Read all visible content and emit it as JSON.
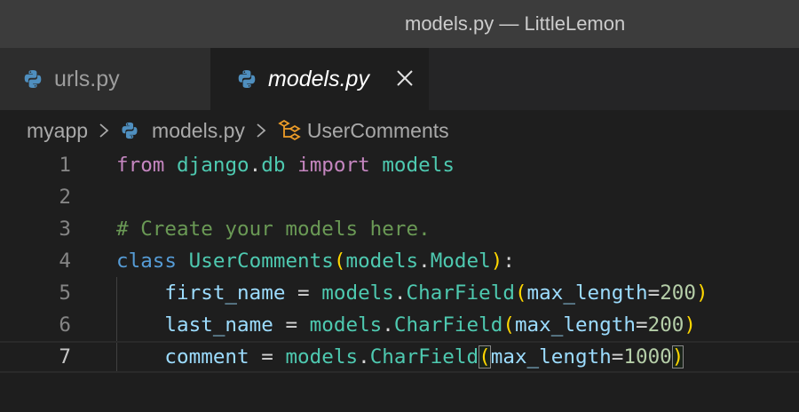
{
  "window": {
    "title": "models.py — LittleLemon"
  },
  "tabs": [
    {
      "label": "urls.py",
      "icon": "python-icon",
      "active": false
    },
    {
      "label": "models.py",
      "icon": "python-icon",
      "active": true,
      "close_icon": "close-icon"
    }
  ],
  "breadcrumb": {
    "items": [
      {
        "label": "myapp"
      },
      {
        "label": "models.py",
        "icon": "python-icon"
      },
      {
        "label": "UserComments",
        "icon": "class-symbol-icon"
      }
    ]
  },
  "editor": {
    "current_line": 7,
    "lines": [
      {
        "number": "1",
        "tokens": [
          [
            "kw",
            "from"
          ],
          [
            "op",
            " "
          ],
          [
            "mod",
            "django"
          ],
          [
            "op",
            "."
          ],
          [
            "mod",
            "db"
          ],
          [
            "op",
            " "
          ],
          [
            "kw",
            "import"
          ],
          [
            "op",
            " "
          ],
          [
            "mod",
            "models"
          ]
        ]
      },
      {
        "number": "2",
        "tokens": []
      },
      {
        "number": "3",
        "tokens": [
          [
            "cm",
            "# Create your models here."
          ]
        ]
      },
      {
        "number": "4",
        "tokens": [
          [
            "kw-blue",
            "class"
          ],
          [
            "op",
            " "
          ],
          [
            "cls",
            "UserComments"
          ],
          [
            "p1",
            "("
          ],
          [
            "mod",
            "models"
          ],
          [
            "op",
            "."
          ],
          [
            "cls",
            "Model"
          ],
          [
            "p1",
            ")"
          ],
          [
            "op",
            ":"
          ]
        ]
      },
      {
        "number": "5",
        "tokens": [
          [
            "op",
            "    "
          ],
          [
            "var",
            "first_name"
          ],
          [
            "op",
            " = "
          ],
          [
            "mod",
            "models"
          ],
          [
            "op",
            "."
          ],
          [
            "cls",
            "CharField"
          ],
          [
            "p1",
            "("
          ],
          [
            "var",
            "max_length"
          ],
          [
            "op",
            "="
          ],
          [
            "num",
            "200"
          ],
          [
            "p1",
            ")"
          ]
        ]
      },
      {
        "number": "6",
        "tokens": [
          [
            "op",
            "    "
          ],
          [
            "var",
            "last_name"
          ],
          [
            "op",
            " = "
          ],
          [
            "mod",
            "models"
          ],
          [
            "op",
            "."
          ],
          [
            "cls",
            "CharField"
          ],
          [
            "p1",
            "("
          ],
          [
            "var",
            "max_length"
          ],
          [
            "op",
            "="
          ],
          [
            "num",
            "200"
          ],
          [
            "p1",
            ")"
          ]
        ]
      },
      {
        "number": "7",
        "tokens": [
          [
            "op",
            "    "
          ],
          [
            "var",
            "comment"
          ],
          [
            "op",
            " = "
          ],
          [
            "mod",
            "models"
          ],
          [
            "op",
            "."
          ],
          [
            "cls",
            "CharField"
          ],
          [
            "p1 bracket-match",
            "("
          ],
          [
            "var",
            "max_length"
          ],
          [
            "op",
            "="
          ],
          [
            "num",
            "1000"
          ],
          [
            "p1 bracket-match",
            ")"
          ]
        ]
      }
    ]
  },
  "colors": {
    "background": "#1e1e1e",
    "titlebar": "#3c3c3c",
    "tab_inactive": "#2d2d2d",
    "keyword": "#c586c0",
    "class_keyword": "#569cd6",
    "type": "#4ec9b0",
    "variable": "#9cdcfe",
    "number": "#b5cea8",
    "comment": "#6a9955",
    "bracket": "#ffd700"
  }
}
